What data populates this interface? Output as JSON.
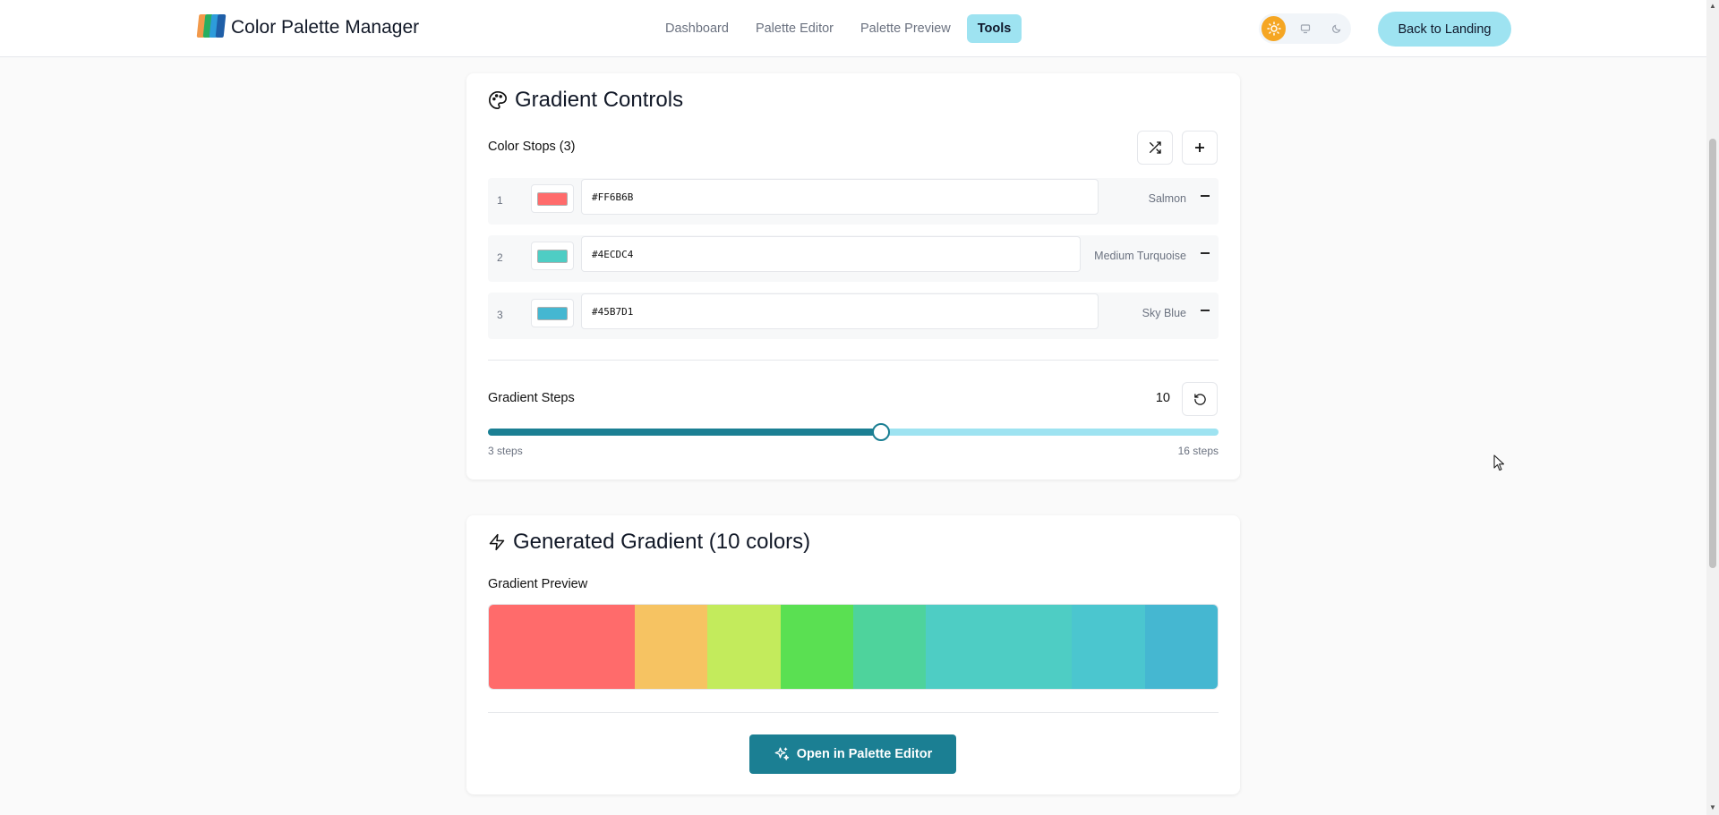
{
  "header": {
    "app_title": "Color Palette Manager",
    "nav": [
      "Dashboard",
      "Palette Editor",
      "Palette Preview",
      "Tools"
    ],
    "active_nav": "Tools",
    "back_button": "Back to Landing",
    "theme_options": [
      "sun-icon",
      "monitor-icon",
      "moon-icon"
    ],
    "active_theme": "light"
  },
  "controls": {
    "title": "Gradient Controls",
    "stops_label": "Color Stops (3)",
    "stops": [
      {
        "index": "1",
        "hex": "#FF6B6B",
        "name": "Salmon",
        "color": "#FF6B6B"
      },
      {
        "index": "2",
        "hex": "#4ECDC4",
        "name": "Medium Turquoise",
        "color": "#4ECDC4"
      },
      {
        "index": "3",
        "hex": "#45B7D1",
        "name": "Sky Blue",
        "color": "#45B7D1"
      }
    ],
    "steps_label": "Gradient Steps",
    "steps_value": "10",
    "slider": {
      "min": 3,
      "max": 16,
      "value": 10
    },
    "range_min_label": "3 steps",
    "range_max_label": "16 steps"
  },
  "generated": {
    "title": "Generated Gradient (10 colors)",
    "preview_label": "Gradient Preview",
    "colors": [
      "#FF6B6B",
      "#FF6B6B",
      "#F6C362",
      "#C3EB5C",
      "#5AE052",
      "#4ED39C",
      "#4ECDC4",
      "#4ECDC4",
      "#4BC6CF",
      "#45B7D1"
    ],
    "open_button": "Open in Palette Editor"
  },
  "colors": {
    "accent": "#1B7F93",
    "accent_light": "#9EE3F1",
    "theme_active": "#F5A623"
  }
}
